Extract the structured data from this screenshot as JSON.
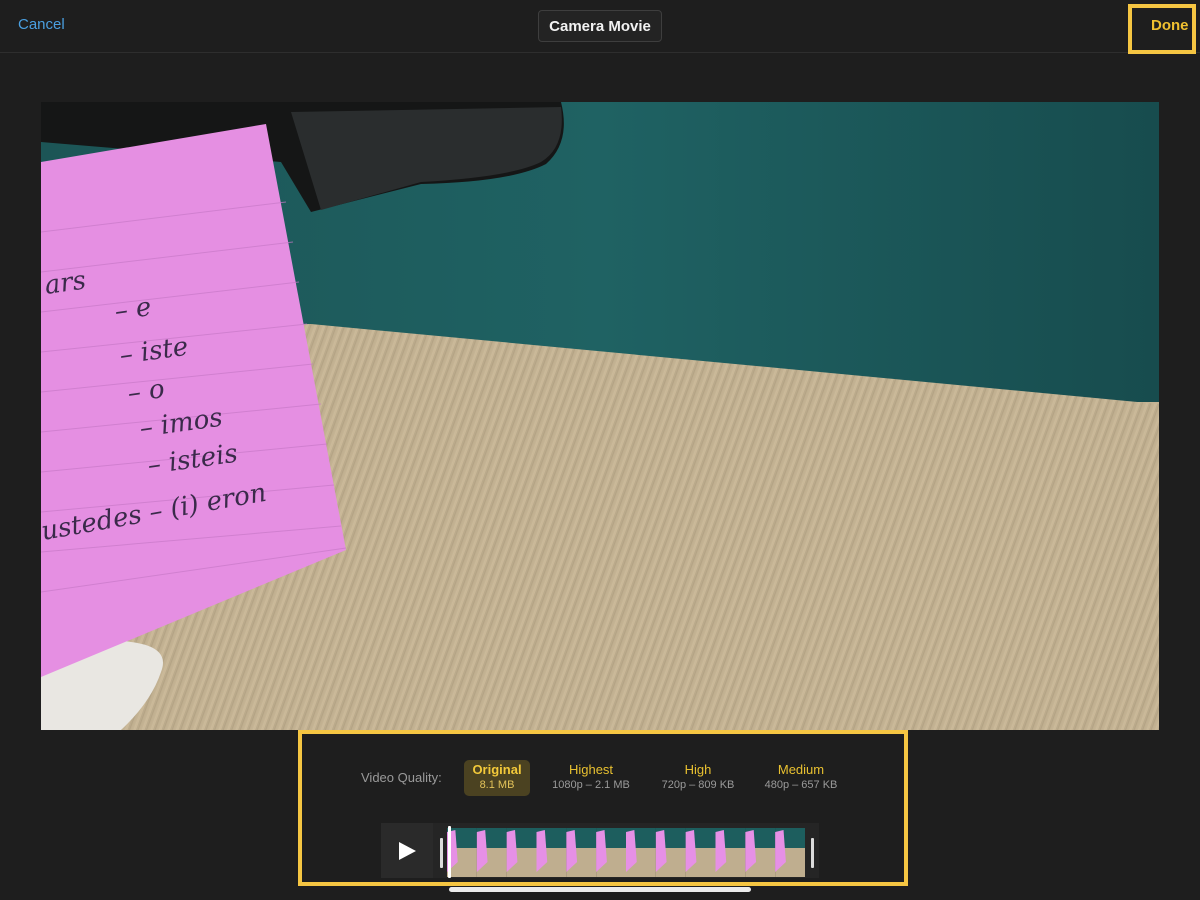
{
  "header": {
    "cancel_label": "Cancel",
    "title": "Camera Movie",
    "done_label": "Done"
  },
  "preview": {
    "note_text": [
      "ars",
      "– e",
      "– iste",
      "– o",
      "– imos",
      "– isteis",
      "ustedes – (i) eron"
    ]
  },
  "quality": {
    "label": "Video Quality:",
    "options": [
      {
        "name": "Original",
        "size": "8.1 MB",
        "selected": true
      },
      {
        "name": "Highest",
        "size": "1080p – 2.1 MB",
        "selected": false
      },
      {
        "name": "High",
        "size": "720p – 809 KB",
        "selected": false
      },
      {
        "name": "Medium",
        "size": "480p – 657 KB",
        "selected": false
      }
    ]
  },
  "timeline": {
    "play_icon": "play-icon",
    "frame_count": 12,
    "playhead_fraction": 0.0
  },
  "colors": {
    "accent_yellow": "#f0c030",
    "link_blue": "#4a9fe0",
    "highlight_border": "#f5c542",
    "note_pink": "#e690e6",
    "wall_teal": "#1d5e5e"
  }
}
